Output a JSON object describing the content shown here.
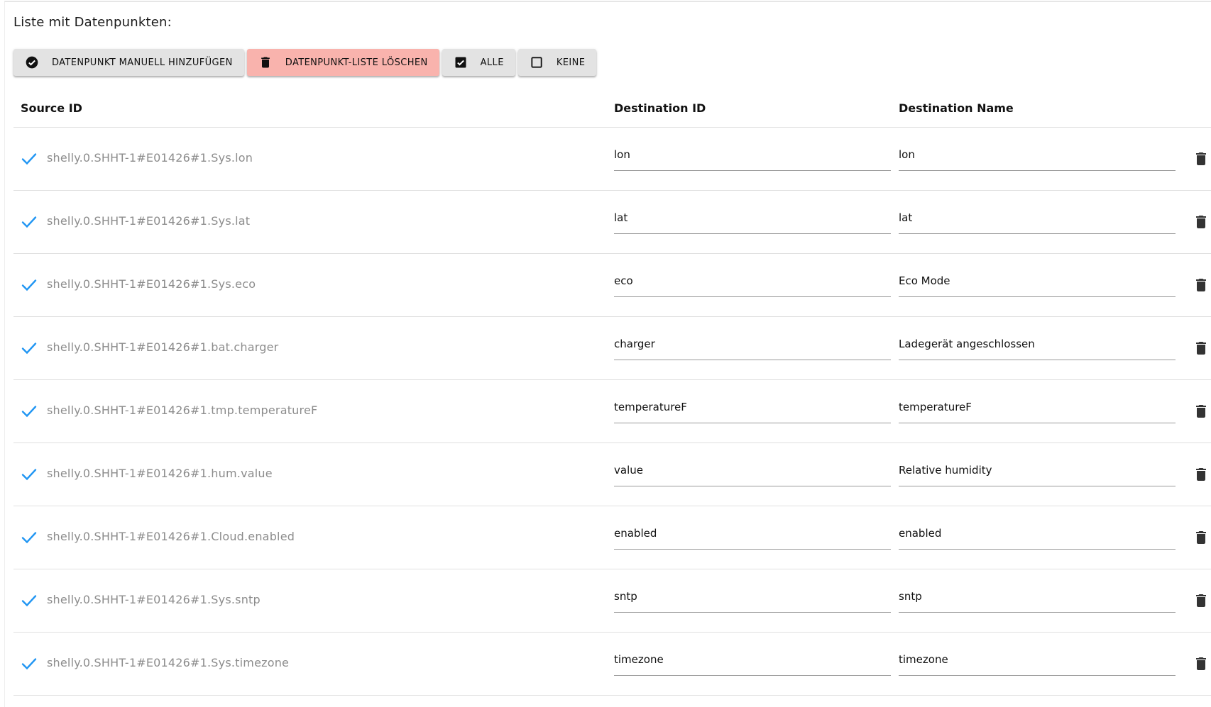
{
  "heading": "Liste mit Datenpunkten:",
  "toolbar": {
    "add_label": "DATENPUNKT MANUELL HINZUFÜGEN",
    "clear_label": "DATENPUNKT-LISTE LÖSCHEN",
    "all_label": "ALLE",
    "none_label": "KEINE"
  },
  "columns": {
    "source_id": "Source ID",
    "destination_id": "Destination ID",
    "destination_name": "Destination Name"
  },
  "colors": {
    "check": "#2196f3",
    "danger_button": "#f9b3ad",
    "button": "#e3e3e3",
    "source_text": "#8c8c8c"
  },
  "rows": [
    {
      "source_id": "shelly.0.SHHT-1#E01426#1.Sys.lon",
      "destination_id": "lon",
      "destination_name": "lon"
    },
    {
      "source_id": "shelly.0.SHHT-1#E01426#1.Sys.lat",
      "destination_id": "lat",
      "destination_name": "lat"
    },
    {
      "source_id": "shelly.0.SHHT-1#E01426#1.Sys.eco",
      "destination_id": "eco",
      "destination_name": "Eco Mode"
    },
    {
      "source_id": "shelly.0.SHHT-1#E01426#1.bat.charger",
      "destination_id": "charger",
      "destination_name": "Ladegerät angeschlossen"
    },
    {
      "source_id": "shelly.0.SHHT-1#E01426#1.tmp.temperatureF",
      "destination_id": "temperatureF",
      "destination_name": "temperatureF"
    },
    {
      "source_id": "shelly.0.SHHT-1#E01426#1.hum.value",
      "destination_id": "value",
      "destination_name": "Relative humidity"
    },
    {
      "source_id": "shelly.0.SHHT-1#E01426#1.Cloud.enabled",
      "destination_id": "enabled",
      "destination_name": "enabled"
    },
    {
      "source_id": "shelly.0.SHHT-1#E01426#1.Sys.sntp",
      "destination_id": "sntp",
      "destination_name": "sntp"
    },
    {
      "source_id": "shelly.0.SHHT-1#E01426#1.Sys.timezone",
      "destination_id": "timezone",
      "destination_name": "timezone"
    }
  ]
}
